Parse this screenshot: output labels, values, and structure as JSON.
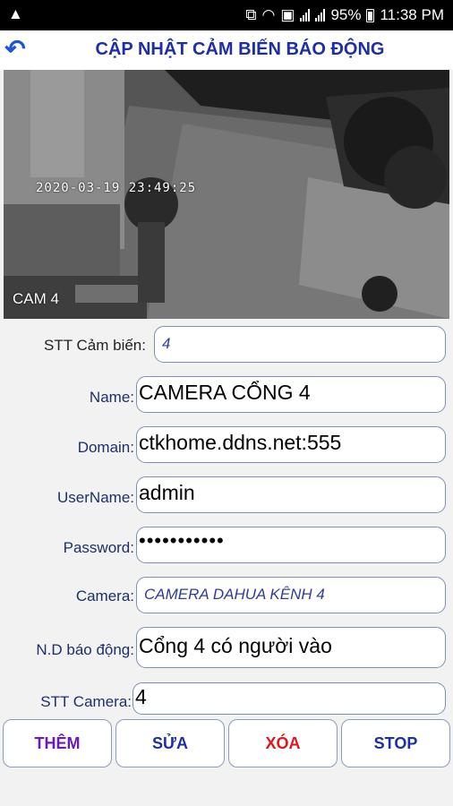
{
  "status": {
    "warning_icon": "warning-icon",
    "battery_percent": "95%",
    "time": "11:38 PM"
  },
  "header": {
    "title": "CẬP NHẬT CẢM BIẾN BÁO ĐỘNG",
    "back_icon": "back-arrow-icon"
  },
  "camera": {
    "timestamp": "2020-03-19 23:49:25",
    "label": "CAM 4"
  },
  "form": {
    "stt_label": "STT Cảm biến:",
    "stt_value": "4",
    "name_label": "Name:",
    "name_value": "CAMERA CỔNG 4",
    "domain_label": "Domain:",
    "domain_value": "ctkhome.ddns.net:555",
    "username_label": "UserName:",
    "username_value": "admin",
    "password_label": "Password:",
    "password_value": "•••••••••••",
    "camera_label": "Camera:",
    "camera_value": "CAMERA DAHUA KÊNH 4",
    "nd_label": "N.D báo động:",
    "nd_value": "Cổng 4 có người vào",
    "stt_camera_label": "STT Camera:",
    "stt_camera_value": "4"
  },
  "buttons": {
    "add": "THÊM",
    "edit": "SỬA",
    "delete": "XÓA",
    "stop": "STOP"
  },
  "colors": {
    "title": "#1d2ea8",
    "add": "#6a1ab8",
    "delete": "#e0151d"
  }
}
